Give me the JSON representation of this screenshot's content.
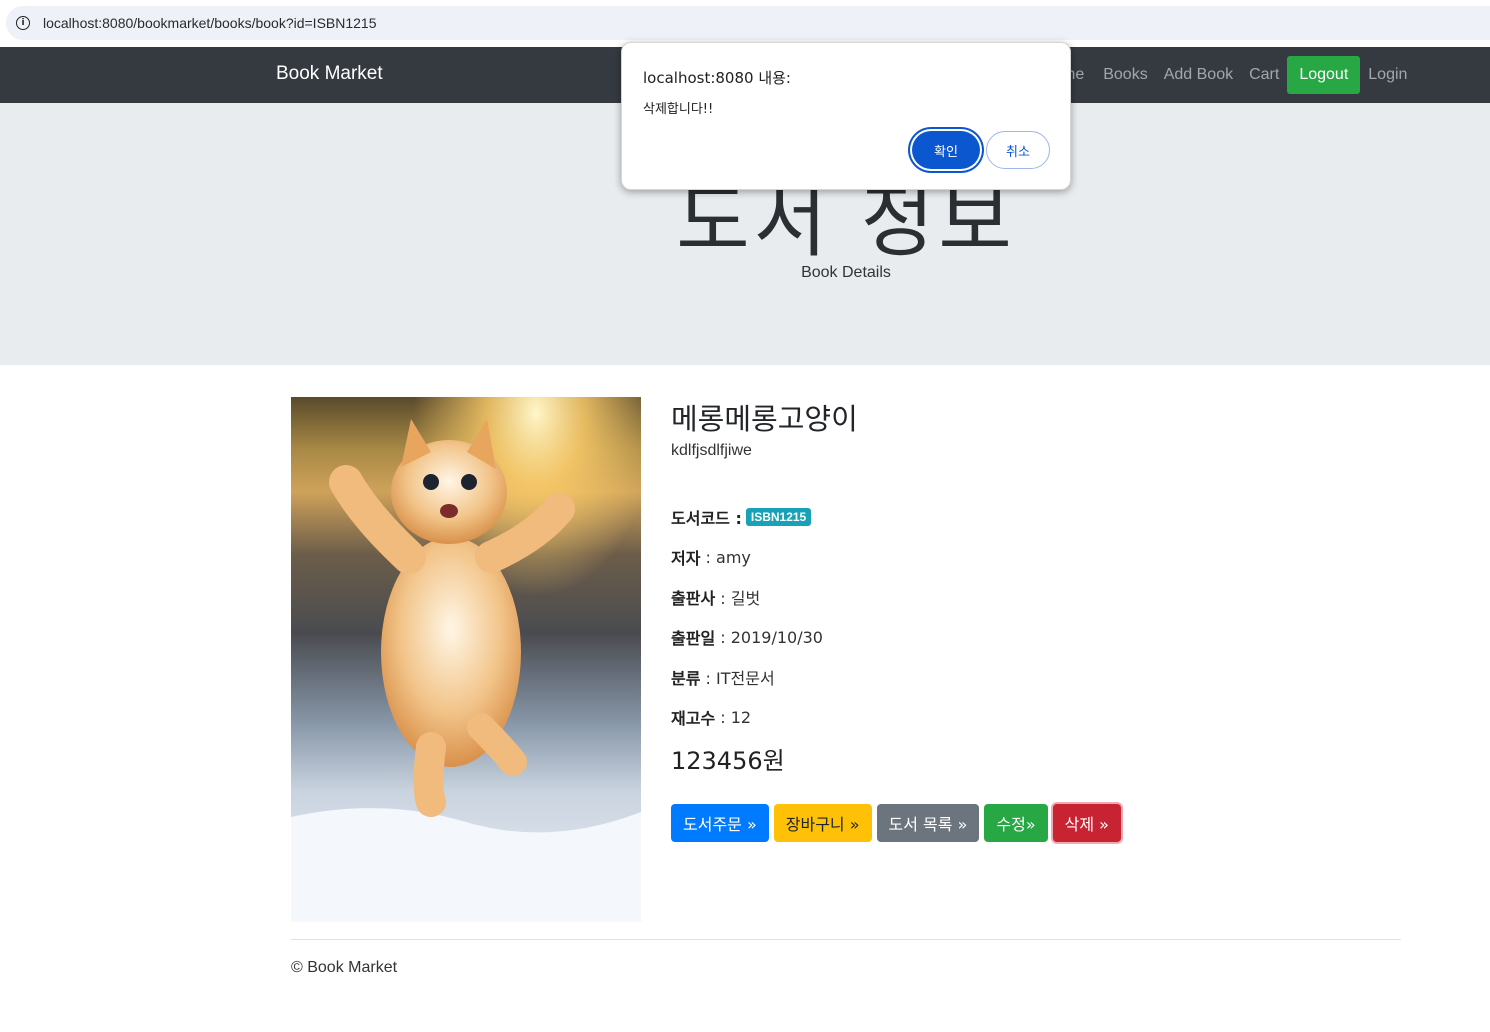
{
  "browser": {
    "url": "localhost:8080/bookmarket/books/book?id=ISBN1215"
  },
  "navbar": {
    "brand": "Book Market",
    "links": [
      "me",
      "Books",
      "Add Book",
      "Cart"
    ],
    "logout": "Logout",
    "login": "Login"
  },
  "jumbotron": {
    "title": "도서 정보",
    "subtitle": "Book Details"
  },
  "dialog": {
    "title": "localhost:8080 내용:",
    "message": "삭제합니다!!",
    "ok": "확인",
    "cancel": "취소"
  },
  "book": {
    "image_alt": "cat-photo",
    "name": "메롱메롱고양이",
    "description": "kdlfjsdlfjiwe",
    "code_label": "도서코드 :",
    "code": "ISBN1215",
    "author_label": "저자",
    "author": " : amy",
    "publisher_label": "출판사",
    "publisher": " : 길벗",
    "release_label": "출판일",
    "release": " : 2019/10/30",
    "category_label": "분류",
    "category": " : IT전문서",
    "stock_label": "재고수",
    "stock": " : 12",
    "price": "123456원"
  },
  "actions": {
    "order": "도서주문 »",
    "cart": "장바구니 »",
    "list": "도서 목록 »",
    "edit": "수정»",
    "delete": "삭제 »"
  },
  "footer": {
    "text": "© Book Market"
  }
}
